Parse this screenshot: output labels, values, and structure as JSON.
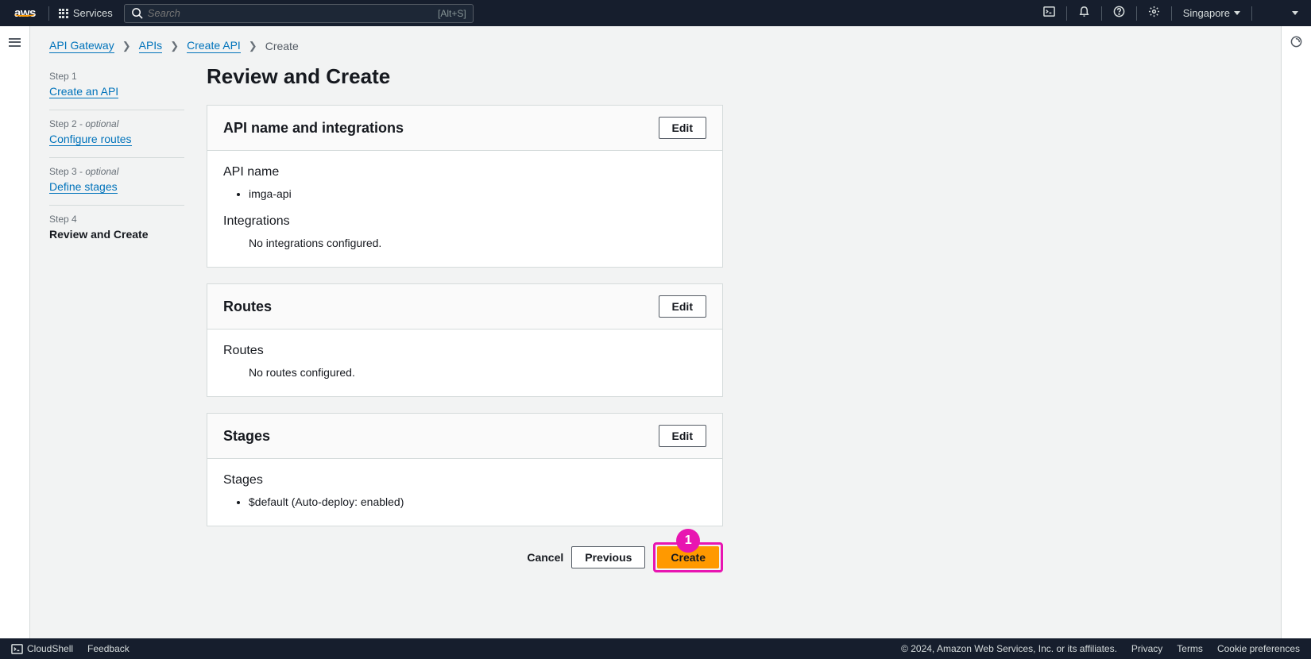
{
  "topnav": {
    "services_label": "Services",
    "search_placeholder": "Search",
    "search_hint": "[Alt+S]",
    "region": "Singapore"
  },
  "breadcrumb": {
    "items": [
      "API Gateway",
      "APIs",
      "Create API",
      "Create"
    ]
  },
  "steps": {
    "s1_label": "Step 1",
    "s1_link": "Create an API",
    "s2_label": "Step 2 - ",
    "s2_opt": "optional",
    "s2_link": "Configure routes",
    "s3_label": "Step 3 - ",
    "s3_opt": "optional",
    "s3_link": "Define stages",
    "s4_label": "Step 4",
    "s4_current": "Review and Create"
  },
  "page": {
    "title": "Review and Create",
    "edit_label": "Edit",
    "panel1": {
      "title": "API name and integrations",
      "h1": "API name",
      "api_name": "imga-api",
      "h2": "Integrations",
      "integrations_text": "No integrations configured."
    },
    "panel2": {
      "title": "Routes",
      "h1": "Routes",
      "routes_text": "No routes configured."
    },
    "panel3": {
      "title": "Stages",
      "h1": "Stages",
      "stage_item": "$default (Auto-deploy: enabled)"
    },
    "actions": {
      "cancel": "Cancel",
      "previous": "Previous",
      "create": "Create",
      "badge": "1"
    }
  },
  "footer": {
    "cloudshell": "CloudShell",
    "feedback": "Feedback",
    "copyright": "© 2024, Amazon Web Services, Inc. or its affiliates.",
    "privacy": "Privacy",
    "terms": "Terms",
    "cookies": "Cookie preferences"
  }
}
